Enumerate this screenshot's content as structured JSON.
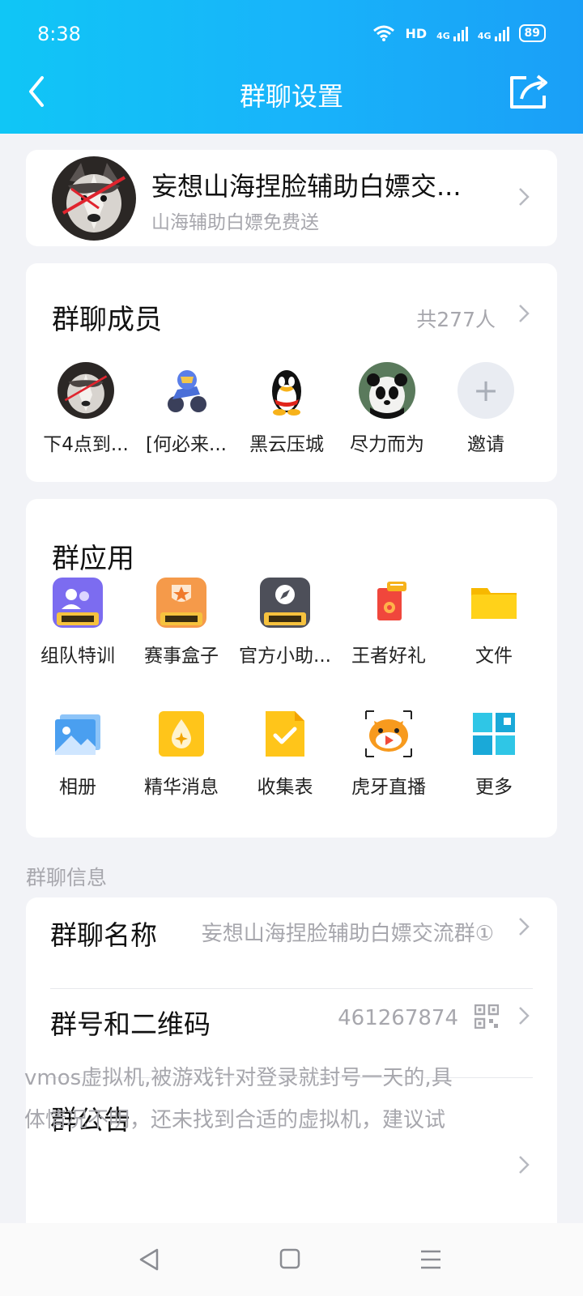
{
  "status": {
    "time": "8:38",
    "network": "HD",
    "sim1": "4G",
    "sim2": "4G",
    "battery": "89"
  },
  "nav": {
    "title": "群聊设置"
  },
  "group": {
    "name": "妄想山海捏脸辅助白嫖交...",
    "subtitle": "山海辅助白嫖免费送"
  },
  "members": {
    "title": "群聊成员",
    "count": "共277人",
    "list": [
      {
        "name": "下4点到..."
      },
      {
        "name": "[何必来..."
      },
      {
        "name": "黑云压城"
      },
      {
        "name": "尽力而为"
      }
    ],
    "invite": "邀请"
  },
  "apps": {
    "title": "群应用",
    "items": [
      {
        "label": "组队特训",
        "icon": "team-training-icon"
      },
      {
        "label": "赛事盒子",
        "icon": "event-box-icon"
      },
      {
        "label": "官方小助...",
        "icon": "official-assistant-icon"
      },
      {
        "label": "王者好礼",
        "icon": "gift-icon"
      },
      {
        "label": "文件",
        "icon": "folder-icon"
      },
      {
        "label": "相册",
        "icon": "album-icon"
      },
      {
        "label": "精华消息",
        "icon": "essence-icon"
      },
      {
        "label": "收集表",
        "icon": "form-icon"
      },
      {
        "label": "虎牙直播",
        "icon": "huya-icon"
      },
      {
        "label": "更多",
        "icon": "more-apps-icon"
      }
    ]
  },
  "info": {
    "section": "群聊信息",
    "name_label": "群聊名称",
    "name_value": "妄想山海捏脸辅助白嫖交流群①",
    "id_label": "群号和二维码",
    "id_value": "461267874",
    "notice_label": "群公告",
    "notice_line1": "vmos虚拟机,被游戏针对登录就封号一天的,具",
    "notice_line2": "体情况不明，还未找到合适的虚拟机，建议试"
  },
  "colors": {
    "header_start": "#10c6f6",
    "header_end": "#1a9ff7",
    "background": "#f2f3f7"
  }
}
